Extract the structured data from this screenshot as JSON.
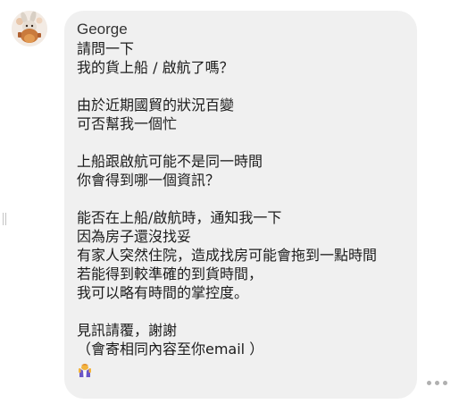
{
  "message": {
    "sender": "George",
    "lines": [
      "請問一下",
      "我的貨上船 / 啟航了嗎？",
      "",
      "由於近期國貿的狀況百變",
      "可否幫我一個忙",
      "",
      "上船跟啟航可能不是同一時間",
      "你會得到哪一個資訊？",
      "",
      "能否在上船/啟航時，通知我一下",
      "因為房子還沒找妥",
      "有家人突然住院，造成找房可能會拖到一點時間",
      "若能得到較準確的到貨時間，",
      "我可以略有時間的掌控度。",
      "",
      "見訊請覆，謝謝",
      "（會寄相同內容至你email ）"
    ],
    "emoji_icon": "man-bowing-icon",
    "avatar_icon": "rabbit-avatar-icon"
  },
  "colors": {
    "bubble": "#f0f0f0",
    "text": "#1c1c1c",
    "sender": "#333333"
  }
}
